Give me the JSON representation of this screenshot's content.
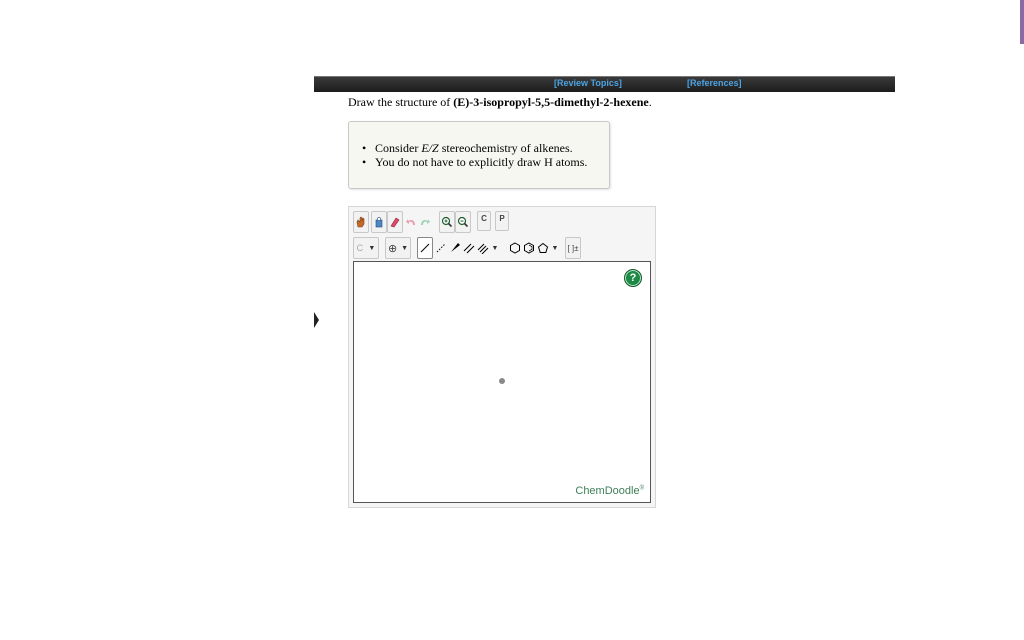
{
  "header": {
    "review_topics": "[Review Topics]",
    "references": "[References]"
  },
  "question": {
    "prefix": "Draw the structure of ",
    "compound": "(E)-3-isopropyl-5,5-dimethyl-2-hexene",
    "suffix": "."
  },
  "hints": {
    "item1_prefix": "Consider ",
    "item1_italic": "E/Z",
    "item1_suffix": " stereochemistry of alkenes.",
    "item2": "You do not have to explicitly draw H atoms."
  },
  "editor": {
    "element_selector_value": "C",
    "charge_symbol": "⊕",
    "clean_button_label": "C",
    "perspective_button_label": "P",
    "bracket_symbol": "[ ]±",
    "help_symbol": "?",
    "brand": "ChemDoodle",
    "brand_mark": "®"
  },
  "colors": {
    "header_link": "#4ba3e3",
    "header_bar": "#1c1c1c",
    "help_green": "#1c8a45",
    "brand_green": "#3f7f57",
    "hint_background": "#f7f7f2"
  }
}
